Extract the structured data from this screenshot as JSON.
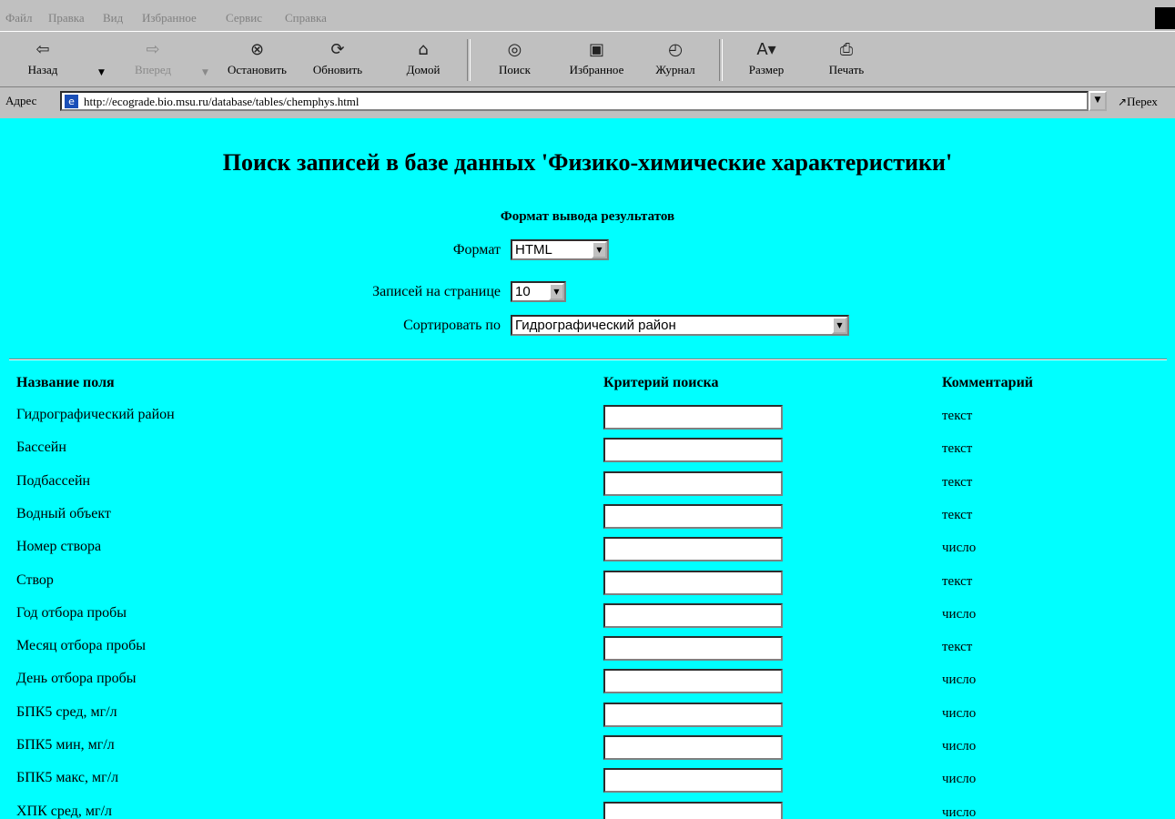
{
  "menu": [
    "Файл",
    "Правка",
    "Вид",
    "Избранное",
    "Сервис",
    "Справка"
  ],
  "toolbar": {
    "back": "Назад",
    "forward": "Вперед",
    "stop": "Остановить",
    "refresh": "Обновить",
    "home": "Домой",
    "search": "Поиск",
    "favorites": "Избранное",
    "history": "Журнал",
    "size": "Размер",
    "print": "Печать"
  },
  "address": {
    "label": "Адрес",
    "url": "http://ecograde.bio.msu.ru/database/tables/chemphys.html",
    "go": "Перех"
  },
  "page": {
    "title": "Поиск записей в базе данных 'Физико-химические характеристики'",
    "format_section": "Формат вывода результатов",
    "format_label": "Формат",
    "format_value": "HTML",
    "per_page_label": "Записей на странице",
    "per_page_value": "10",
    "sort_label": "Сортировать по",
    "sort_value": "Гидрографический район"
  },
  "table": {
    "headers": {
      "field": "Название поля",
      "criteria": "Критерий поиска",
      "comment": "Комментарий"
    },
    "rows": [
      {
        "name": "Гидрографический район",
        "comment": "текст"
      },
      {
        "name": "Бассейн",
        "comment": "текст"
      },
      {
        "name": "Подбассейн",
        "comment": "текст"
      },
      {
        "name": "Водный объект",
        "comment": "текст"
      },
      {
        "name": "Номер створа",
        "comment": "число"
      },
      {
        "name": "Створ",
        "comment": "текст"
      },
      {
        "name": "Год отбора пробы",
        "comment": "число"
      },
      {
        "name": "Месяц отбора пробы",
        "comment": "текст"
      },
      {
        "name": "День отбора пробы",
        "comment": "число"
      },
      {
        "name": "БПК5 сред, мг/л",
        "comment": "число"
      },
      {
        "name": "БПК5 мин, мг/л",
        "comment": "число"
      },
      {
        "name": "БПК5 макс, мг/л",
        "comment": "число"
      },
      {
        "name": "ХПК сред, мг/л",
        "comment": "число"
      }
    ]
  }
}
